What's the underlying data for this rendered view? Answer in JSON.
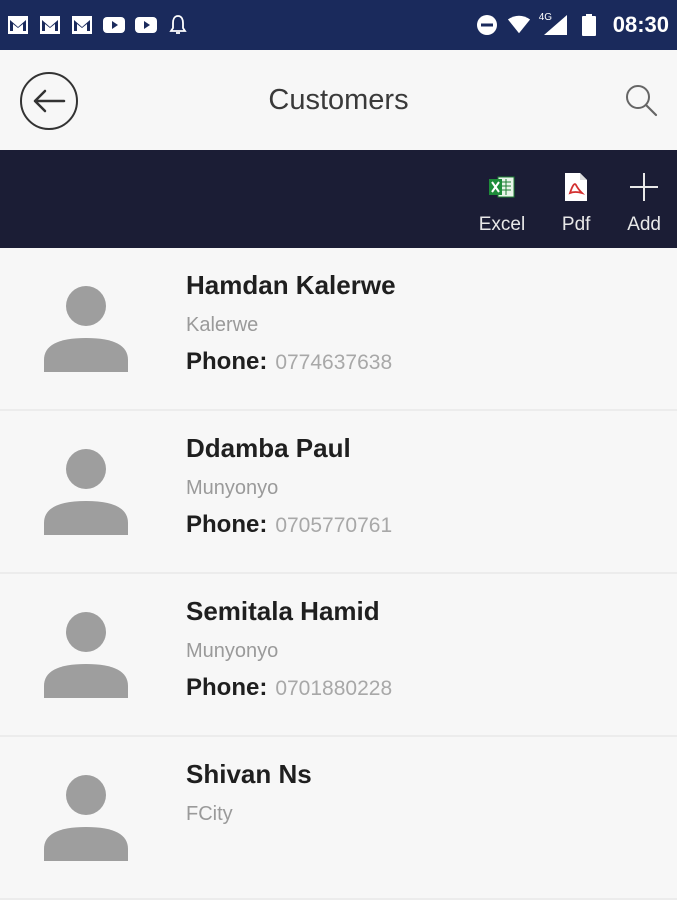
{
  "status_bar": {
    "time": "08:30",
    "network": "4G"
  },
  "app_bar": {
    "title": "Customers"
  },
  "toolbar": {
    "excel_label": "Excel",
    "pdf_label": "Pdf",
    "add_label": "Add"
  },
  "customers": [
    {
      "name": "Hamdan Kalerwe",
      "area": "Kalerwe",
      "phone_label": "Phone:",
      "phone": "0774637638"
    },
    {
      "name": "Ddamba Paul",
      "area": "Munyonyo",
      "phone_label": "Phone:",
      "phone": "0705770761"
    },
    {
      "name": "Semitala Hamid",
      "area": "Munyonyo",
      "phone_label": "Phone:",
      "phone": "0701880228"
    },
    {
      "name": "Shivan Ns",
      "area": "FCity"
    }
  ],
  "colors": {
    "status_bar": "#1a2a5c",
    "toolbar": "#1b1d35",
    "avatar": "#9e9e9e"
  }
}
